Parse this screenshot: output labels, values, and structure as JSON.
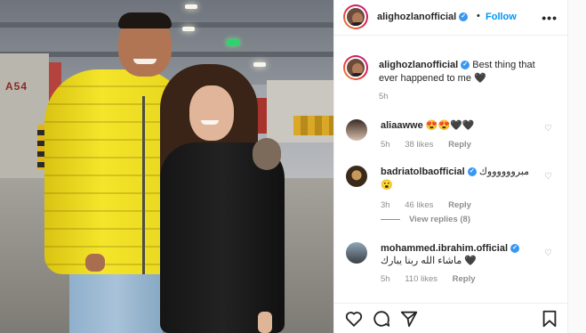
{
  "photo": {
    "pillar_label": "A54",
    "colors": {
      "jacket": "#f4e52a",
      "coat": "#1a1a1a",
      "exit_sign": "#2ed36a"
    }
  },
  "header": {
    "username": "alighozlanofficial",
    "separator": "•",
    "follow_label": "Follow",
    "more_icon": "more-horizontal-icon"
  },
  "caption": {
    "username": "alighozlanofficial",
    "text": "Best thing that ever happened to me",
    "emoji": "🖤",
    "time": "5h"
  },
  "comments": [
    {
      "username": "aliaawwe",
      "text": "😍😍🖤🖤",
      "time": "5h",
      "likes": "38 likes",
      "reply": "Reply",
      "verified": false
    },
    {
      "username": "badriatolbaofficial",
      "text": "مبرووووووك",
      "text2": "😮",
      "time": "3h",
      "likes": "46 likes",
      "reply": "Reply",
      "verified": true,
      "view_replies": "View replies (8)"
    },
    {
      "username": "mohammed.ibrahim.official",
      "text": "ماشاء الله ربنا يبارك 🖤",
      "time": "5h",
      "likes": "110 likes",
      "reply": "Reply",
      "verified": true
    }
  ],
  "actions": [
    "heart-icon",
    "comment-icon",
    "share-icon",
    "bookmark-icon"
  ],
  "accent": "#0095f6"
}
